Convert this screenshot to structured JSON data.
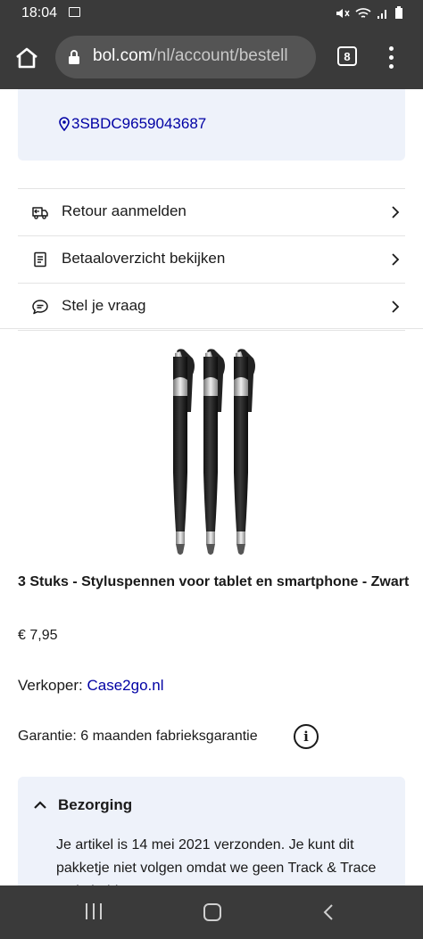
{
  "status_bar": {
    "time": "18:04",
    "icons": [
      "image-icon",
      "mute-icon",
      "wifi-icon",
      "signal-icon",
      "battery-icon"
    ]
  },
  "browser": {
    "url_domain": "bol.com",
    "url_path": "/nl/account/bestell",
    "tab_count": "8",
    "icons": [
      "home-icon",
      "lock-icon",
      "tabs-icon",
      "more-vert-icon"
    ]
  },
  "tracking": {
    "code": "3SBDC9659043687",
    "icon": "location-pin-icon"
  },
  "actions": [
    {
      "label": "Retour aanmelden",
      "icon": "truck-return-icon"
    },
    {
      "label": "Betaaloverzicht bekijken",
      "icon": "receipt-icon"
    },
    {
      "label": "Stel je vraag",
      "icon": "chat-icon"
    }
  ],
  "product": {
    "image": "stylus-pens-image",
    "title": "3 Stuks - Styluspennen voor tablet en smartphone - Zwart",
    "price": "€ 7,95",
    "seller_label": "Verkoper: ",
    "seller_name": "Case2go.nl",
    "warranty": "Garantie: 6 maanden fabrieksgarantie",
    "info_glyph": "i"
  },
  "delivery": {
    "heading": "Bezorging",
    "text": "Je artikel is 14 mei 2021 verzonden. Je kunt dit pakketje niet volgen omdat we geen Track & Trace code hebben."
  },
  "nav_bar": {
    "icons": [
      "recents-icon",
      "home-nav-icon",
      "back-icon"
    ]
  },
  "colors": {
    "chrome_dark": "#3a3a3a",
    "link_blue": "#0000a4",
    "panel_bg": "#eef2fa"
  }
}
